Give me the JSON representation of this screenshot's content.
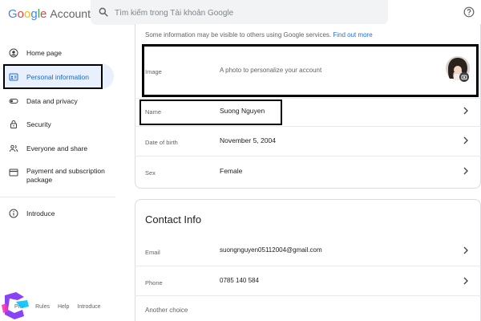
{
  "header": {
    "logo_google": "Google",
    "logo_account": "Account",
    "search_placeholder": "Tìm kiếm trong Tài khoản Google"
  },
  "sidebar": {
    "items": [
      {
        "label": "Home page",
        "icon": "account-circle-icon"
      },
      {
        "label": "Personal information",
        "icon": "id-card-icon"
      },
      {
        "label": "Data and privacy",
        "icon": "toggle-icon"
      },
      {
        "label": "Security",
        "icon": "lock-icon"
      },
      {
        "label": "Everyone and share",
        "icon": "people-icon"
      },
      {
        "label": "Payment and subscription package",
        "icon": "credit-card-icon"
      },
      {
        "label": "Introduce",
        "icon": "info-icon"
      }
    ],
    "footer": {
      "privacy": "Priv",
      "rules": "Rules",
      "help": "Help",
      "introduce": "Introduce"
    }
  },
  "basic_info": {
    "notice": "Some information may be visible to others using Google services.",
    "notice_link": "Find out more",
    "image_label": "Image",
    "image_desc": "A photo to personalize your account",
    "name_label": "Name",
    "name_value": "Suong Nguyen",
    "dob_label": "Date of birth",
    "dob_value": "November 5, 2004",
    "sex_label": "Sex",
    "sex_value": "Female"
  },
  "contact": {
    "title": "Contact Info",
    "email_label": "Email",
    "email_value": "suongnguyen05112004@gmail.com",
    "phone_label": "Phone",
    "phone_value": "0785 140 584",
    "other_label": "Another choice"
  }
}
